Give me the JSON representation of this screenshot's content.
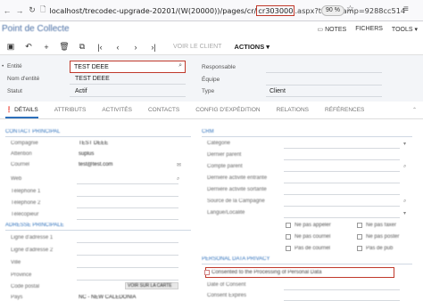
{
  "browser": {
    "url_prefix": "localhost/trecodec-upgrade-20201/(W(20000))/pages/cr/",
    "url_highlight": "cr303000",
    "url_suffix": ".aspx?timeStamp=9288cc514",
    "zoom": "90 %"
  },
  "app": {
    "title": "Point de Collecte",
    "links": [
      "NOTES",
      "FICHERS",
      "TOOLS"
    ]
  },
  "toolbar": {
    "voir_client": "VOIR LE CLIENT",
    "actions": "ACTIONS"
  },
  "header": {
    "entite_label": "Entité",
    "entite_value": "TEST DEEE",
    "nom_label": "Nom d'entité",
    "nom_value": "TEST DEEE",
    "statut_label": "Statut",
    "statut_value": "Actif",
    "responsable_label": "Responsable",
    "equipe_label": "Équipe",
    "type_label": "Type",
    "type_value": "Client"
  },
  "tabs": [
    "DÉTAILS",
    "ATTRIBUTS",
    "ACTIVITÉS",
    "CONTACTS",
    "CONFIG D'EXPÉDITION",
    "RELATIONS",
    "RÉFÉRENCES"
  ],
  "left": {
    "contact_section": "CONTACT PRINCIPAL",
    "contact_fields": [
      {
        "label": "Compagnie",
        "value": "TEST DEEE"
      },
      {
        "label": "Attention",
        "value": "suplus"
      },
      {
        "label": "Courriel",
        "value": "test@test.com"
      },
      {
        "label": "Web",
        "value": ""
      },
      {
        "label": "Téléphone 1",
        "value": ""
      },
      {
        "label": "Téléphone 2",
        "value": ""
      },
      {
        "label": "Télécopieur",
        "value": ""
      }
    ],
    "address_section": "ADRESSE PRINCIPALE",
    "address_fields": [
      {
        "label": "Ligne d'adresse 1",
        "value": ""
      },
      {
        "label": "Ligne d'adresse 2",
        "value": ""
      },
      {
        "label": "Ville",
        "value": ""
      },
      {
        "label": "Province",
        "value": ""
      },
      {
        "label": "Code postal",
        "value": "VOIR SUR LA CARTE"
      },
      {
        "label": "Pays",
        "value": "NC - NEW CALEDONIA"
      }
    ]
  },
  "right": {
    "crm_section": "CRM",
    "crm_fields": [
      "Catégorie",
      "Dernier parent",
      "Compte parent",
      "Dernière activité entrante",
      "Dernière activité sortante",
      "Source de la Campagne",
      "Langue/Localité"
    ],
    "checkboxes": [
      {
        "label": "Ne pas appeler"
      },
      {
        "label": "Ne pas faxer"
      },
      {
        "label": "Ne pas courriel"
      },
      {
        "label": "Ne pas poster"
      },
      {
        "label": "Pas de courriel"
      },
      {
        "label": "Pas de pub"
      }
    ],
    "privacy_section": "PERSONAL DATA PRIVACY",
    "consent_label": "Consented to the Processing of Personal Data",
    "date_consent": "Date of Consent",
    "consent_expires": "Consent Expires"
  }
}
